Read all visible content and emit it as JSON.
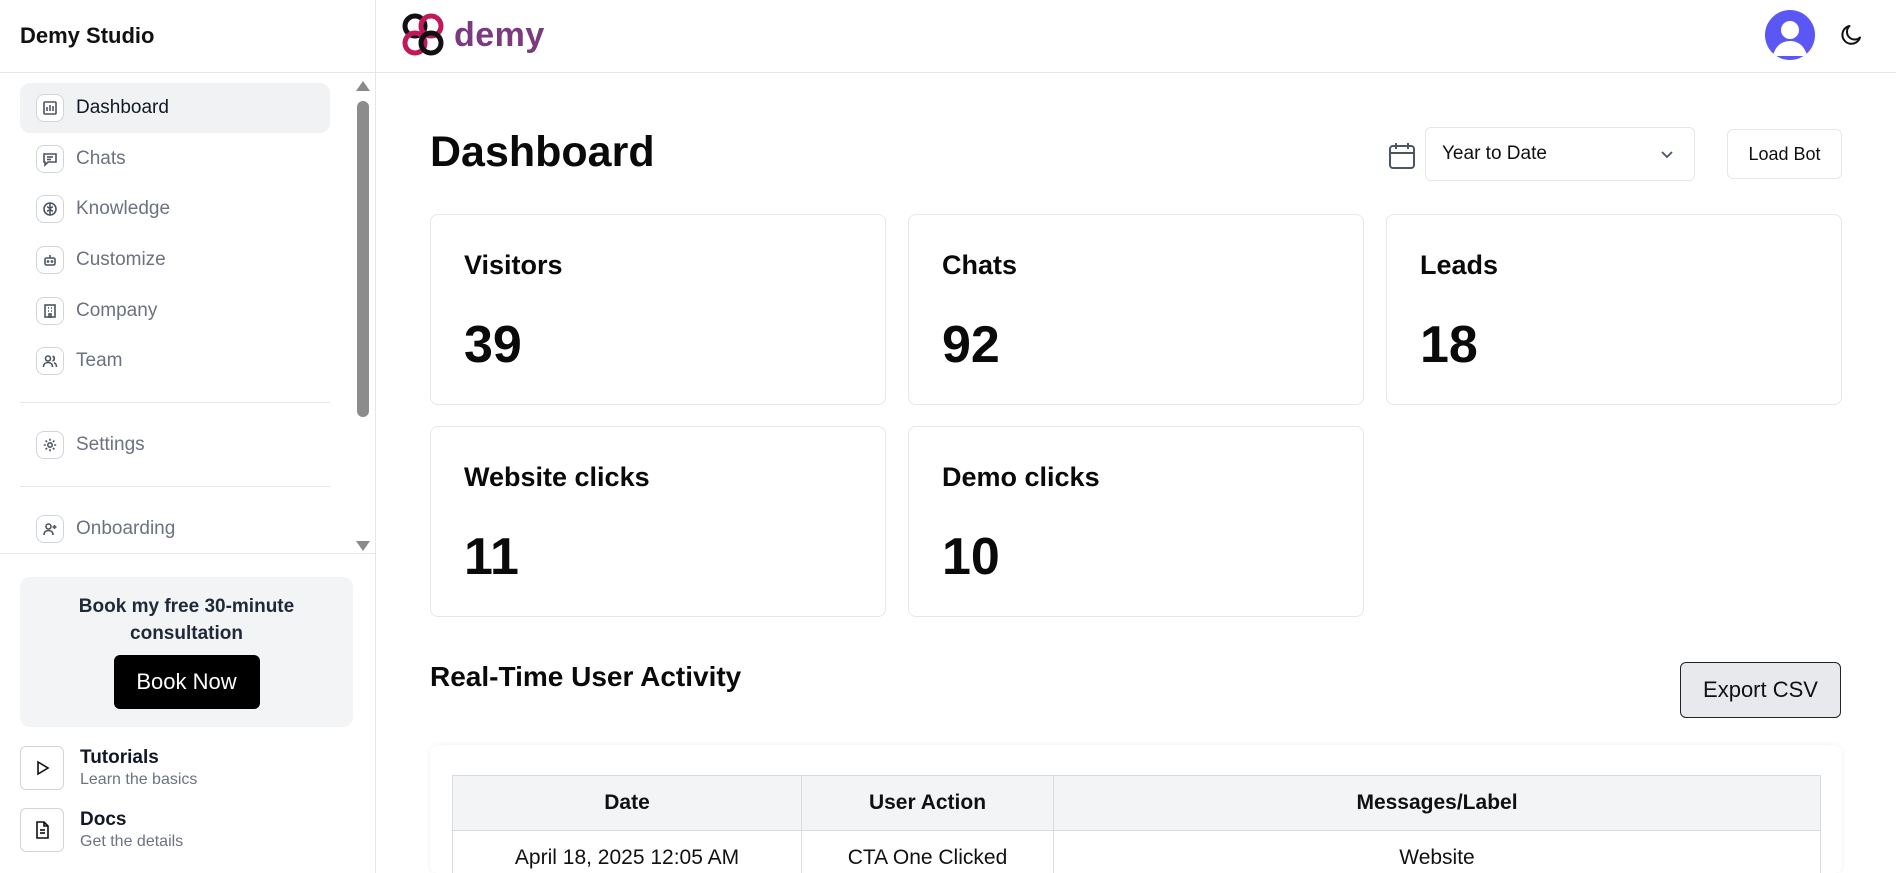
{
  "app": {
    "studio_name": "Demy Studio",
    "brand": "demy",
    "brand_color": "#7b3a7e"
  },
  "sidebar": {
    "items": [
      {
        "label": "Dashboard",
        "icon": "chart-icon",
        "active": true
      },
      {
        "label": "Chats",
        "icon": "chat-icon",
        "active": false
      },
      {
        "label": "Knowledge",
        "icon": "brain-icon",
        "active": false
      },
      {
        "label": "Customize",
        "icon": "bot-icon",
        "active": false
      },
      {
        "label": "Company",
        "icon": "building-icon",
        "active": false
      },
      {
        "label": "Team",
        "icon": "users-icon",
        "active": false
      }
    ],
    "settings": {
      "label": "Settings",
      "icon": "gear-icon"
    },
    "onboarding": {
      "label": "Onboarding",
      "icon": "user-plus-icon"
    },
    "promo": {
      "text": "Book my free 30-minute consultation",
      "button": "Book Now"
    },
    "resources": [
      {
        "title": "Tutorials",
        "subtitle": "Learn the basics",
        "icon": "play-icon"
      },
      {
        "title": "Docs",
        "subtitle": "Get the details",
        "icon": "document-icon"
      }
    ]
  },
  "header": {
    "avatar_color": "#5b57f5",
    "theme_icon": "moon-icon"
  },
  "main": {
    "title": "Dashboard",
    "date_range": "Year to Date",
    "load_bot_label": "Load Bot",
    "stats": [
      {
        "label": "Visitors",
        "value": "39"
      },
      {
        "label": "Chats",
        "value": "92"
      },
      {
        "label": "Leads",
        "value": "18"
      },
      {
        "label": "Website clicks",
        "value": "11"
      },
      {
        "label": "Demo clicks",
        "value": "10"
      }
    ],
    "activity": {
      "title": "Real-Time User Activity",
      "export_label": "Export CSV",
      "columns": [
        "Date",
        "User Action",
        "Messages/Label"
      ],
      "rows": [
        [
          "April 18, 2025 12:05 AM",
          "CTA One Clicked",
          "Website"
        ]
      ]
    }
  }
}
